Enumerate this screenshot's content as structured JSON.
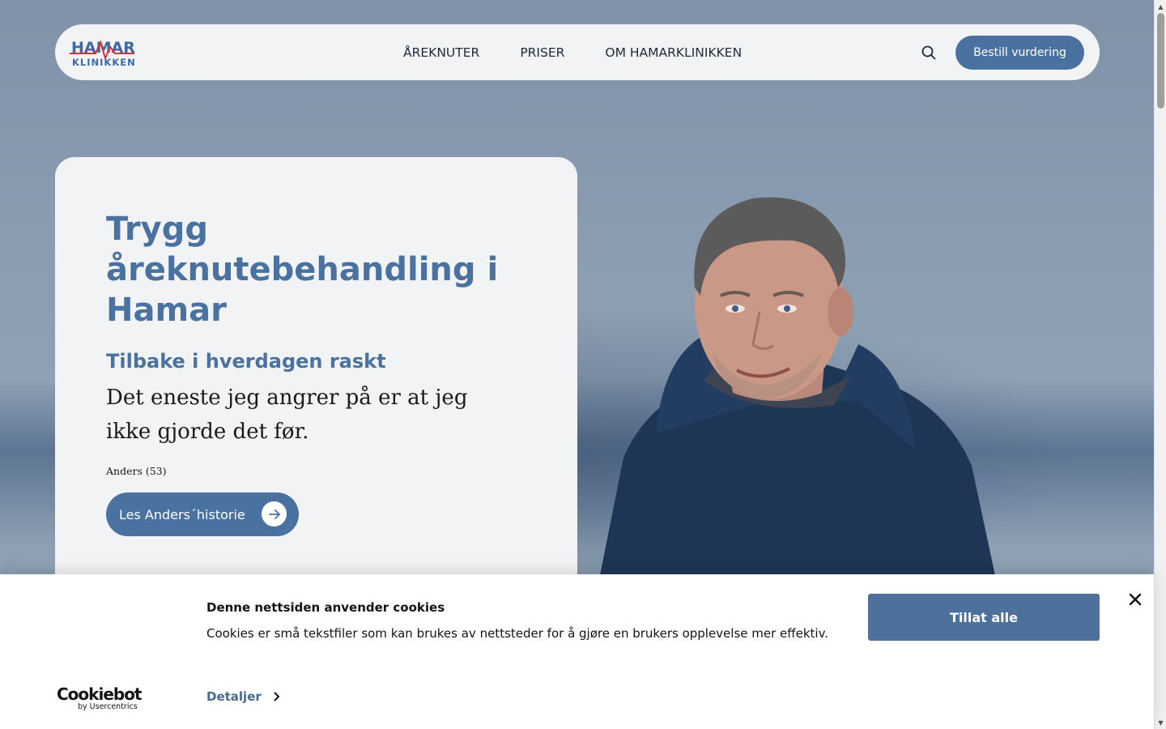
{
  "header": {
    "logo_top": "HAMAR",
    "logo_bottom": "KLINIKKEN",
    "nav": [
      "ÅREKNUTER",
      "PRISER",
      "OM HAMARKLINIKKEN"
    ],
    "cta_label": "Bestill vurdering"
  },
  "hero": {
    "title": "Trygg åreknutebehandling i Hamar",
    "subtitle": "Tilbake i hverdagen raskt",
    "quote": "Det eneste jeg angrer på er at jeg ikke gjorde det før.",
    "author": "Anders (53)",
    "story_button": "Les Anders´historie"
  },
  "cookie": {
    "title": "Denne nettsiden anvender cookies",
    "text": "Cookies er små tekstfiler som kan brukes av nettsteder for å gjøre en brukers opplevelse mer effektiv.",
    "details_label": "Detaljer",
    "allow_label": "Tillat alle",
    "brand": "Cookiebot",
    "brand_by": "by Usercentrics"
  },
  "colors": {
    "accent": "#4a72a0",
    "nav_bg": "#f2f3f5",
    "logo_red": "#d6323b"
  },
  "icons": [
    "search-icon",
    "arrow-right-icon",
    "close-icon",
    "chevron-right-icon"
  ]
}
